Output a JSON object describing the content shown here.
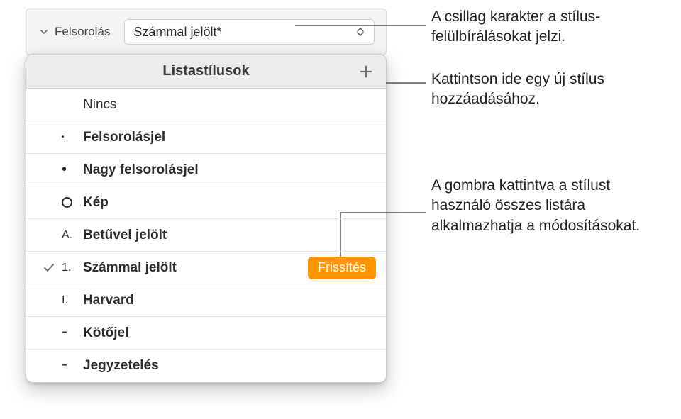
{
  "header": {
    "label": "Felsorolás",
    "select_value": "Számmal jelölt*"
  },
  "popover": {
    "title": "Listastílusok",
    "update_label": "Frissítés",
    "items": [
      {
        "bullet": "",
        "label": "Nincs",
        "bold": false,
        "bullet_type": "none"
      },
      {
        "bullet": "•",
        "label": "Felsorolásjel",
        "bold": true,
        "bullet_type": "small"
      },
      {
        "bullet": "•",
        "label": "Nagy felsorolásjel",
        "bold": true,
        "bullet_type": "big"
      },
      {
        "bullet": "ring",
        "label": "Kép",
        "bold": true,
        "bullet_type": "ring"
      },
      {
        "bullet": "A.",
        "label": "Betűvel jelölt",
        "bold": true,
        "bullet_type": "text"
      },
      {
        "bullet": "1.",
        "label": "Számmal jelölt",
        "bold": true,
        "bullet_type": "text",
        "selected": true,
        "show_update": true
      },
      {
        "bullet": "I.",
        "label": "Harvard",
        "bold": true,
        "bullet_type": "text"
      },
      {
        "bullet": "-",
        "label": "Kötőjel",
        "bold": true,
        "bullet_type": "dash"
      },
      {
        "bullet": "-",
        "label": "Jegyzetelés",
        "bold": true,
        "bullet_type": "dash"
      }
    ]
  },
  "annotations": {
    "a1": "A csillag karakter a stílus-felülbírálásokat jelzi.",
    "a2": "Kattintson ide egy új stílus hozzáadásához.",
    "a3": "A gombra kattintva a stílust használó összes listára alkalmazhatja a módosításokat."
  }
}
